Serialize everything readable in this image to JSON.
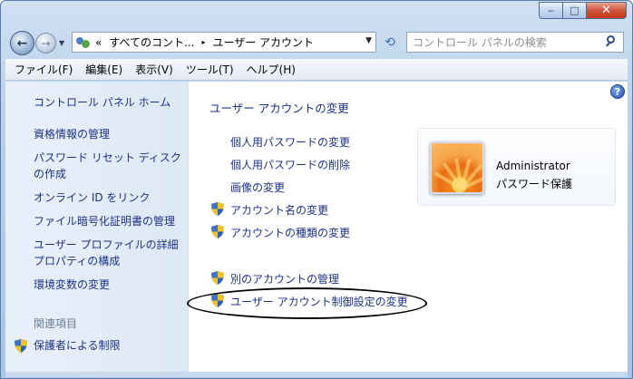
{
  "window": {
    "minimize_symbol": "‒",
    "maximize_symbol": "□",
    "close_symbol": "✕"
  },
  "navigation": {
    "back_symbol": "←",
    "forward_symbol": "→",
    "dropdown_symbol": "▼"
  },
  "address_bar": {
    "chevrons": "«",
    "segments": [
      "すべてのコント...",
      "ユーザー アカウント"
    ],
    "separator": "▸",
    "dropdown_symbol": "▼",
    "refresh_symbol": "⟲"
  },
  "search": {
    "placeholder": "コントロール パネルの検索"
  },
  "menubar": {
    "items": [
      "ファイル(F)",
      "編集(E)",
      "表示(V)",
      "ツール(T)",
      "ヘルプ(H)"
    ]
  },
  "sidebar": {
    "home_link": "コントロール パネル ホーム",
    "links": [
      "資格情報の管理",
      "パスワード リセット ディスク",
      "の作成",
      "オンライン ID をリンク",
      "ファイル暗号化証明書の管理",
      "ユーザー プロファイルの詳細",
      "プロパティの構成",
      "環境変数の変更"
    ],
    "related_heading": "関連項目",
    "related_links": [
      "保護者による制限"
    ]
  },
  "main": {
    "title": "ユーザー アカウントの変更",
    "tasks": [
      "個人用パスワードの変更",
      "個人用パスワードの削除",
      "画像の変更",
      "アカウント名の変更",
      "アカウントの種類の変更"
    ],
    "other_tasks": [
      "別のアカウントの管理",
      "ユーザー アカウント制御設定の変更"
    ],
    "help_symbol": "?"
  },
  "account": {
    "name": "Administrator",
    "status": "パスワード保護",
    "picture": "flower-icon"
  },
  "colors": {
    "link": "#1e3287",
    "sidebar_bg": "#e3ecf8",
    "muted": "#6d7d95"
  }
}
